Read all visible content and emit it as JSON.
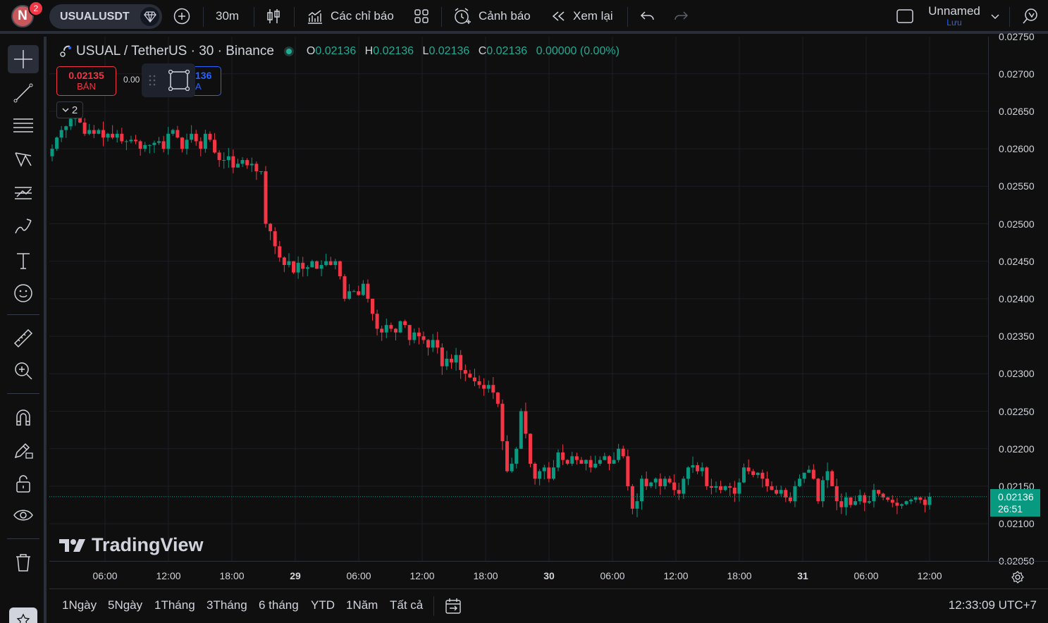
{
  "header": {
    "avatar_letter": "N",
    "notification_count": "2",
    "symbol": "USUALUSDT",
    "interval": "30m",
    "indicators_label": "Các chỉ báo",
    "alerts_label": "Cảnh báo",
    "replay_label": "Xem lại",
    "layout_name": "Unnamed",
    "save_label": "Lưu"
  },
  "legend": {
    "title": "USUAL / TetherUS · 30 · Binance",
    "o_key": "O",
    "o_val": "0.02136",
    "h_key": "H",
    "h_val": "0.02136",
    "l_key": "L",
    "l_val": "0.02136",
    "c_key": "C",
    "c_val": "0.02136",
    "change": "0.00000 (0.00%)"
  },
  "trade": {
    "sell_price": "0.02135",
    "sell_label": "BÁN",
    "spread": "0.00",
    "buy_price": "136",
    "buy_label": "A",
    "collapse_count": "2"
  },
  "price_axis": {
    "labels": [
      "0.02750",
      "0.02700",
      "0.02650",
      "0.02600",
      "0.02550",
      "0.02500",
      "0.02450",
      "0.02400",
      "0.02350",
      "0.02300",
      "0.02250",
      "0.02200",
      "0.02150",
      "0.02100",
      "0.02050"
    ],
    "last_price": "0.02136",
    "countdown": "26:51"
  },
  "time_axis": {
    "labels": [
      "06:00",
      "12:00",
      "18:00",
      "29",
      "06:00",
      "12:00",
      "18:00",
      "30",
      "06:00",
      "12:00",
      "18:00",
      "31",
      "06:00",
      "12:00"
    ]
  },
  "watermark": "TradingView",
  "bottom": {
    "ranges": [
      "1Ngày",
      "5Ngày",
      "1Tháng",
      "3Tháng",
      "6 tháng",
      "YTD",
      "1Năm",
      "Tất cả"
    ],
    "clock": "12:33:09 UTC+7"
  },
  "colors": {
    "up": "#089981",
    "down": "#f23645",
    "background": "#0f0f0f",
    "grid": "#1c1f26"
  },
  "chart_data": {
    "type": "candlestick",
    "symbol": "USUAL / TetherUS",
    "interval": "30",
    "exchange": "Binance",
    "ylim": [
      0.0205,
      0.0275
    ],
    "x_ticks": [
      "06:00",
      "12:00",
      "18:00",
      "29",
      "06:00",
      "12:00",
      "18:00",
      "30",
      "06:00",
      "12:00",
      "18:00",
      "31",
      "06:00",
      "12:00"
    ],
    "last_price": 0.02136,
    "closes": [
      0.026,
      0.02615,
      0.02625,
      0.0263,
      0.0264,
      0.02655,
      0.02635,
      0.0262,
      0.02625,
      0.0262,
      0.02625,
      0.02615,
      0.0262,
      0.02615,
      0.0262,
      0.0261,
      0.0261,
      0.02612,
      0.0261,
      0.026,
      0.02605,
      0.02605,
      0.02608,
      0.0261,
      0.026,
      0.0262,
      0.02625,
      0.02615,
      0.026,
      0.02612,
      0.0262,
      0.0261,
      0.026,
      0.0262,
      0.02612,
      0.02595,
      0.02585,
      0.02585,
      0.0259,
      0.02575,
      0.0258,
      0.02585,
      0.02578,
      0.0258,
      0.0257,
      0.0257,
      0.025,
      0.0249,
      0.0247,
      0.02455,
      0.02445,
      0.0245,
      0.02435,
      0.02448,
      0.0244,
      0.02442,
      0.0245,
      0.0244,
      0.02445,
      0.0245,
      0.02445,
      0.0245,
      0.0243,
      0.024,
      0.0241,
      0.0241,
      0.02405,
      0.0242,
      0.024,
      0.0238,
      0.0236,
      0.02355,
      0.02365,
      0.0236,
      0.02355,
      0.0237,
      0.02365,
      0.02345,
      0.02355,
      0.0235,
      0.02345,
      0.02335,
      0.02345,
      0.02335,
      0.0231,
      0.0232,
      0.02315,
      0.02325,
      0.02305,
      0.023,
      0.02295,
      0.0229,
      0.02285,
      0.0228,
      0.02285,
      0.02275,
      0.0226,
      0.0221,
      0.0217,
      0.0218,
      0.022,
      0.0225,
      0.0222,
      0.0218,
      0.0216,
      0.0217,
      0.02175,
      0.0216,
      0.02175,
      0.02195,
      0.02185,
      0.0218,
      0.0219,
      0.02185,
      0.0218,
      0.02185,
      0.02175,
      0.0218,
      0.02185,
      0.0219,
      0.0218,
      0.02185,
      0.022,
      0.0219,
      0.0215,
      0.0212,
      0.0213,
      0.0216,
      0.0215,
      0.02155,
      0.0216,
      0.0215,
      0.0216,
      0.02155,
      0.02145,
      0.0214,
      0.0216,
      0.02175,
      0.02178,
      0.0217,
      0.02175,
      0.0215,
      0.02148,
      0.0215,
      0.02145,
      0.0215,
      0.02148,
      0.0214,
      0.02155,
      0.02175,
      0.0217,
      0.02165,
      0.02168,
      0.0216,
      0.0215,
      0.02145,
      0.0214,
      0.02145,
      0.02135,
      0.0213,
      0.0215,
      0.0216,
      0.02168,
      0.02172,
      0.0216,
      0.0213,
      0.02158,
      0.0217,
      0.0215,
      0.0213,
      0.02122,
      0.02135,
      0.02125,
      0.0213,
      0.02138,
      0.02128,
      0.0213,
      0.02145,
      0.0214,
      0.02135,
      0.02132,
      0.02128,
      0.02124,
      0.02126,
      0.0213,
      0.02132,
      0.02135,
      0.02132,
      0.02125,
      0.02136
    ]
  }
}
